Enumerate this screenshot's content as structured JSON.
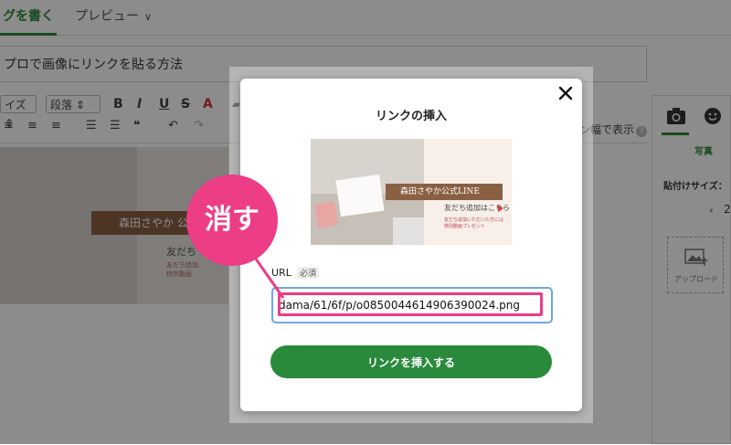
{
  "editor": {
    "tabs": [
      {
        "label": "グを書く"
      },
      {
        "label": "プレビュー"
      }
    ],
    "title_text": "プロで画像にリンクを貼る方法",
    "toolbar": {
      "size_label": "イズ",
      "para_label": "段落",
      "bold": "B",
      "italic": "I",
      "underline": "U",
      "strike": "S",
      "color": "A",
      "quote": "❝"
    },
    "fit_label": "ン幅で表示",
    "help": "?",
    "photo": {
      "banner": "森田さやか 公",
      "line1": "友だち",
      "line2": "友だち追加",
      "line3": "特別動画"
    }
  },
  "sidebar": {
    "photo_label": "写真",
    "size_label": "貼付けサイズ：",
    "size_value": "2",
    "upload_label": "アップロード"
  },
  "modal": {
    "title": "リンクの挿入",
    "preview": {
      "banner": "森田さやか公式LINE",
      "line1": "友だち追加はこちら",
      "line2": "友だち追加いただいた方には",
      "line3": "特別動画プレゼント"
    },
    "url_label": "URL",
    "url_required": "必須",
    "url_value": "dama/61/6f/p/o0850044614906390024.png",
    "button_label": "リンクを挿入する"
  },
  "callout": {
    "text": "消す",
    "color": "#ec3d86"
  },
  "colors": {
    "accent": "#2a8a3c",
    "input_border": "#6fa6e0"
  }
}
